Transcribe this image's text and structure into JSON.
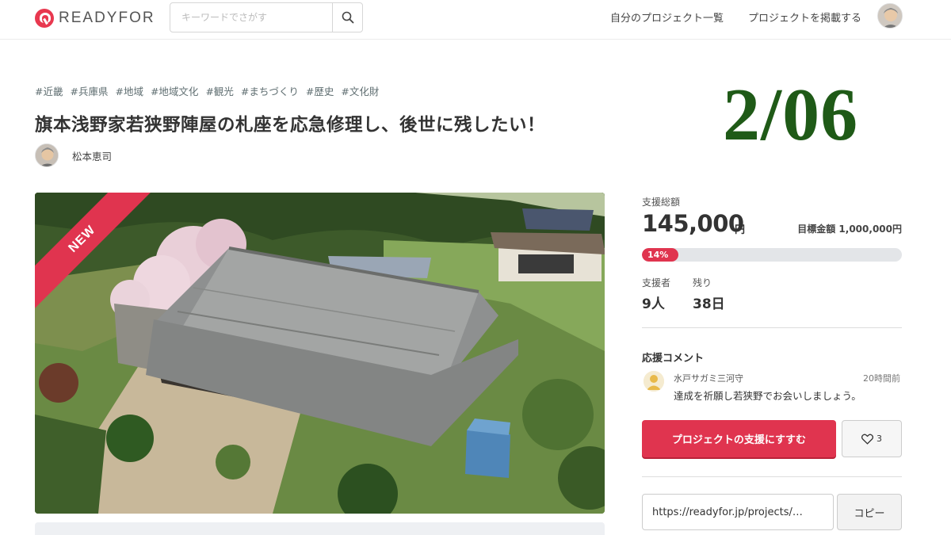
{
  "header": {
    "logo_text": "READYFOR",
    "search_placeholder": "キーワードでさがす",
    "nav": [
      "自分のプロジェクト一覧",
      "プロジェクトを掲載する"
    ]
  },
  "project": {
    "tags": [
      "#近畿",
      "#兵庫県",
      "#地域",
      "#地域文化",
      "#観光",
      "#まちづくり",
      "#歴史",
      "#文化財"
    ],
    "title": "旗本浅野家若狭野陣屋の札座を応急修理し、後世に残したい！",
    "author": "松本恵司",
    "date_stamp": "2/06",
    "badge": "NEW"
  },
  "stats": {
    "total_label": "支援総額",
    "total_amount": "145,000",
    "total_unit": "円",
    "goal_text": "目標金額 1,000,000円",
    "progress_text": "14%",
    "progress_fraction": 0.14,
    "supporters_label": "支援者",
    "supporters_value": "9人",
    "remaining_label": "残り",
    "remaining_value": "38日"
  },
  "comments": {
    "heading": "応援コメント",
    "items": [
      {
        "user": "水戸サガミ三河守",
        "time": "20時間前",
        "body": "達成を祈願し若狭野でお会いしましょう。"
      }
    ]
  },
  "actions": {
    "support_label": "プロジェクトの支援にすすむ",
    "like_count": "3",
    "share_url": "https://readyfor.jp/projects/…",
    "copy_label": "コピー"
  },
  "colors": {
    "brand": "#e0344f",
    "date_stamp": "#1f5a17"
  }
}
